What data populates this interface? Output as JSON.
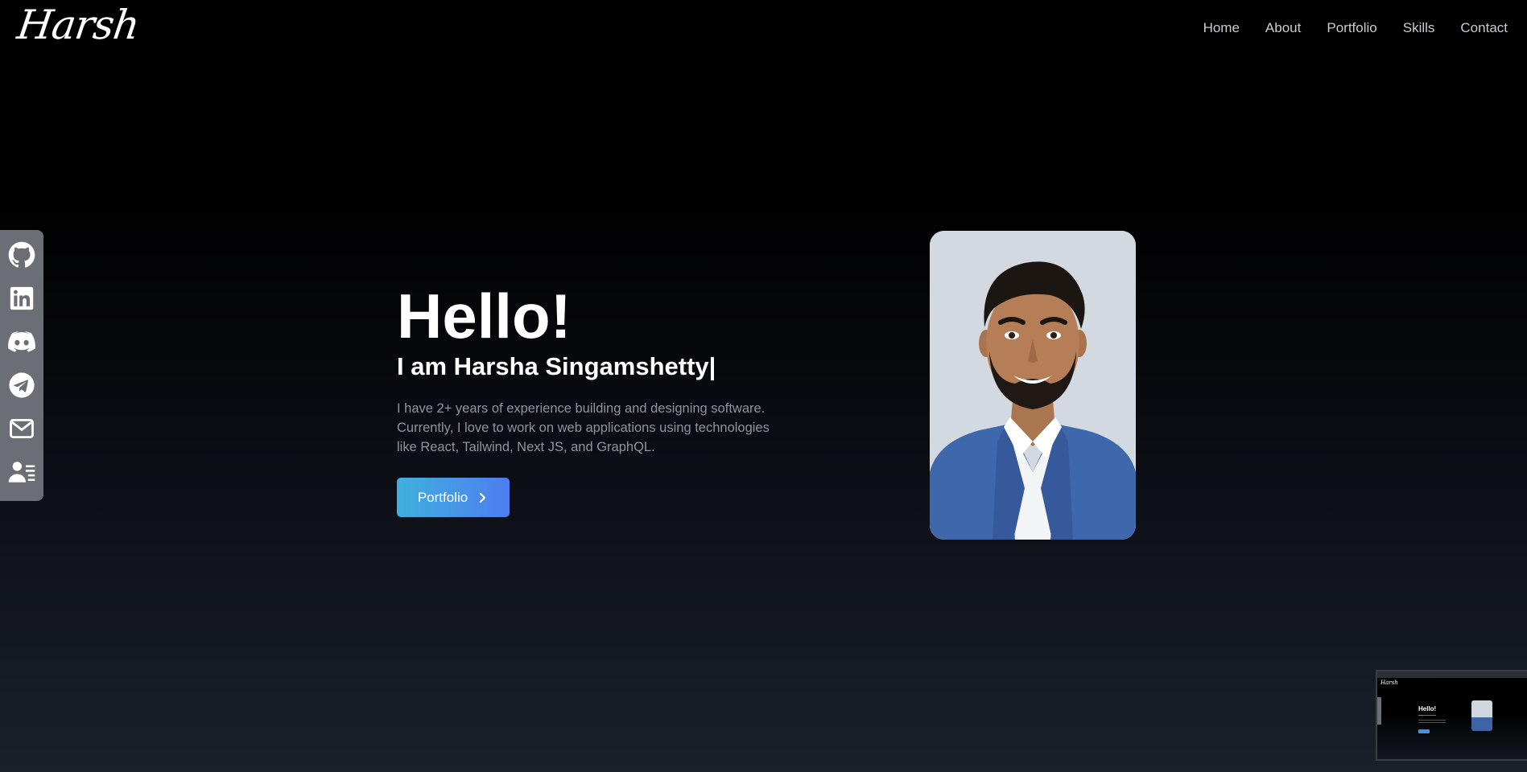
{
  "header": {
    "logo_text": "Harsh",
    "nav": [
      {
        "label": "Home"
      },
      {
        "label": "About"
      },
      {
        "label": "Portfolio"
      },
      {
        "label": "Skills"
      },
      {
        "label": "Contact"
      }
    ]
  },
  "social": [
    {
      "icon": "github-icon"
    },
    {
      "icon": "linkedin-icon"
    },
    {
      "icon": "discord-icon"
    },
    {
      "icon": "telegram-icon"
    },
    {
      "icon": "mail-icon"
    },
    {
      "icon": "resume-icon"
    }
  ],
  "hero": {
    "title": "Hello!",
    "subtitle": "I am Harsha Singamshetty",
    "cursor": "|",
    "description": "I have 2+ years of experience building and designing software. Currently, I love to work on web applications using technologies like React, Tailwind, Next JS, and GraphQL.",
    "button_label": "Portfolio",
    "button_icon": "chevron-right-icon"
  },
  "thumbnail": {
    "hello": "Hello!"
  },
  "colors": {
    "button_gradient_start": "#3fb0dd",
    "button_gradient_end": "#4e7df0",
    "sidebar_bg": "#6b6e74",
    "nav_text": "#c9ccd2",
    "desc_text": "#8e939c"
  }
}
